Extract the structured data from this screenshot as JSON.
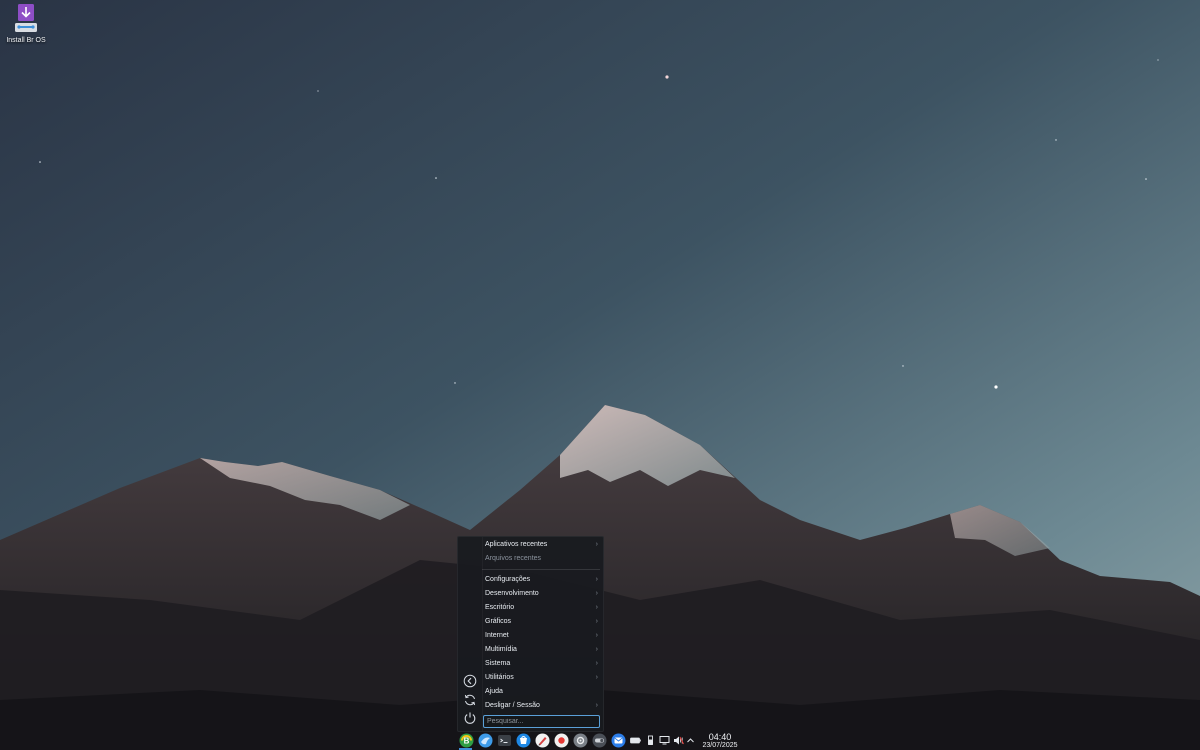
{
  "desktop": {
    "icons": [
      {
        "label": "Install Br OS",
        "icon": "installer-download-icon",
        "accent": "#8e4ec6"
      }
    ]
  },
  "menu": {
    "items": [
      {
        "label": "Aplicativos recentes",
        "has_submenu": true
      },
      {
        "label": "Arquivos recentes",
        "has_submenu": false,
        "disabled": true
      },
      {
        "label": "Configurações",
        "has_submenu": true
      },
      {
        "label": "Desenvolvimento",
        "has_submenu": true
      },
      {
        "label": "Escritório",
        "has_submenu": true
      },
      {
        "label": "Gráficos",
        "has_submenu": true
      },
      {
        "label": "Internet",
        "has_submenu": true
      },
      {
        "label": "Multimídia",
        "has_submenu": true
      },
      {
        "label": "Sistema",
        "has_submenu": true
      },
      {
        "label": "Utilitários",
        "has_submenu": true
      },
      {
        "label": "Ajuda",
        "has_submenu": false
      },
      {
        "label": "Desligar / Sessão",
        "has_submenu": true
      }
    ],
    "submenu_arrow": "›",
    "sidebar_icons": [
      "back-arrow-icon",
      "refresh-icon",
      "power-icon"
    ],
    "search_placeholder": "Pesquisar..."
  },
  "taskbar": {
    "launchers": [
      "br-os-menu-icon",
      "browser-icon",
      "terminal-icon",
      "store-icon",
      "pen-tool-icon",
      "screen-recorder-icon",
      "settings-icon",
      "toggle-switch-icon",
      "mail-icon"
    ],
    "tray": [
      "battery-icon",
      "usb-device-icon",
      "display-icon",
      "speaker-muted-icon",
      "chevron-up-icon"
    ],
    "clock": {
      "time": "04:40",
      "date": "23/07/2025"
    },
    "accent": "#3d8fd8"
  }
}
